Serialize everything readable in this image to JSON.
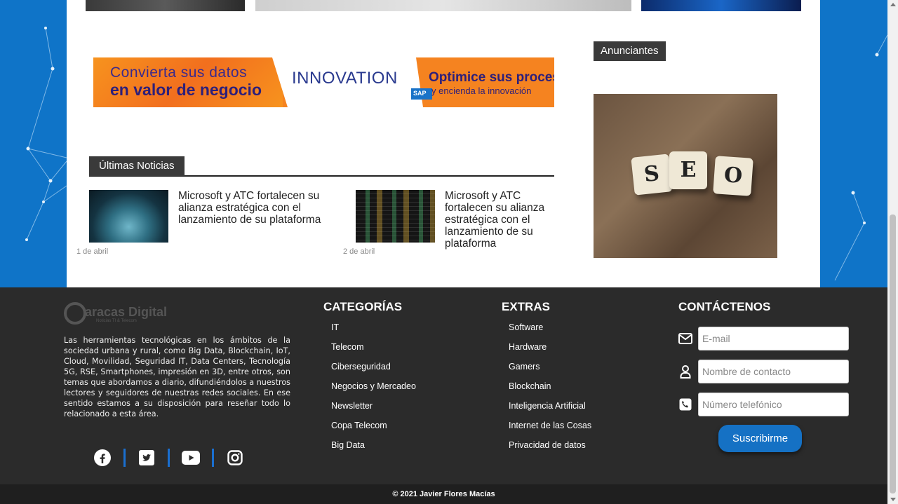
{
  "banner": {
    "left_line1": "Convierta sus datos",
    "left_line2": "en valor de negocio",
    "brand": "INNOVATION",
    "sap": "SAP",
    "right_line1": "Optimice sus procesos",
    "right_line2": "y encienda la innovación"
  },
  "latest": {
    "heading": "Últimas Noticias",
    "items": [
      {
        "title": "Microsoft y ATC fortalecen su alianza estratégica con el lanzamiento de su plataforma",
        "date": "1 de abril"
      },
      {
        "title": "Microsoft y ATC fortalecen su alianza estratégica con el lanzamiento de su plataforma",
        "date": "2 de abril"
      }
    ]
  },
  "sidebar": {
    "ads_heading": "Anunciantes",
    "seo_tiles": [
      "S",
      "E",
      "O"
    ]
  },
  "footer": {
    "logo": {
      "title": "aracas Digital",
      "subtitle": "Noticias TI & Telecom"
    },
    "about": "Las herramientas tecnológicas en los ámbitos de la sociedad urbana y rural, como Big Data, Blockchain, IoT, Cloud, Movilidad, Seguridad IT, Data Centers, Tecnología 5G, RSE, Smartphones, impresión en 3D, entre otros, son temas que abordamos a diario, difundiéndolos a nuestros lectores y seguidores de nuestras redes sociales. En ese sentido estamos a su disposición para reseñar todo lo relacionado a esta área.",
    "social_icons": [
      "facebook-icon",
      "twitter-icon",
      "youtube-icon",
      "instagram-icon"
    ],
    "categories": {
      "heading": "CATEGORÍAS",
      "items": [
        "IT",
        "Telecom",
        "Ciberseguridad",
        "Negocios y Mercadeo",
        "Newsletter",
        "Copa Telecom",
        "Big Data"
      ]
    },
    "extras": {
      "heading": "EXTRAS",
      "items": [
        "Software",
        "Hardware",
        "Gamers",
        "Blockchain",
        "Inteligencia Artificial",
        "Internet de las Cosas",
        "Privacidad de datos"
      ]
    },
    "contact": {
      "heading": "CONTÁCTENOS",
      "email_placeholder": "E-mail",
      "name_placeholder": "Nombre de contacto",
      "phone_placeholder": "Número telefónico",
      "subscribe_label": "Suscribirme"
    },
    "copyright": "© 2021 Javier Flores Macías"
  },
  "colors": {
    "accent_blue": "#0f74c8",
    "footer_bg": "#2b2b2b",
    "button_blue": "#1571c4"
  }
}
